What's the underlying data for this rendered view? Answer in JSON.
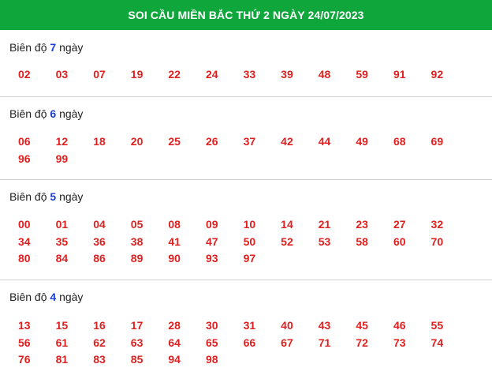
{
  "header": {
    "title": "SOI CẦU MIỀN BẮC THỨ 2 NGÀY 24/07/2023"
  },
  "sections": [
    {
      "prefix": "Biên độ",
      "days": "7",
      "suffix": "ngày",
      "numbers": [
        "02",
        "03",
        "07",
        "19",
        "22",
        "24",
        "33",
        "39",
        "48",
        "59",
        "91",
        "92"
      ]
    },
    {
      "prefix": "Biên độ",
      "days": "6",
      "suffix": "ngày",
      "numbers": [
        "06",
        "12",
        "18",
        "20",
        "25",
        "26",
        "37",
        "42",
        "44",
        "49",
        "68",
        "69",
        "96",
        "99"
      ]
    },
    {
      "prefix": "Biên độ",
      "days": "5",
      "suffix": "ngày",
      "numbers": [
        "00",
        "01",
        "04",
        "05",
        "08",
        "09",
        "10",
        "14",
        "21",
        "23",
        "27",
        "32",
        "34",
        "35",
        "36",
        "38",
        "41",
        "47",
        "50",
        "52",
        "53",
        "58",
        "60",
        "70",
        "80",
        "84",
        "86",
        "89",
        "90",
        "93",
        "97"
      ]
    },
    {
      "prefix": "Biên độ",
      "days": "4",
      "suffix": "ngày",
      "numbers": [
        "13",
        "15",
        "16",
        "17",
        "28",
        "30",
        "31",
        "40",
        "43",
        "45",
        "46",
        "55",
        "56",
        "61",
        "62",
        "63",
        "64",
        "65",
        "66",
        "67",
        "71",
        "72",
        "73",
        "74",
        "76",
        "81",
        "83",
        "85",
        "94",
        "98"
      ]
    }
  ]
}
